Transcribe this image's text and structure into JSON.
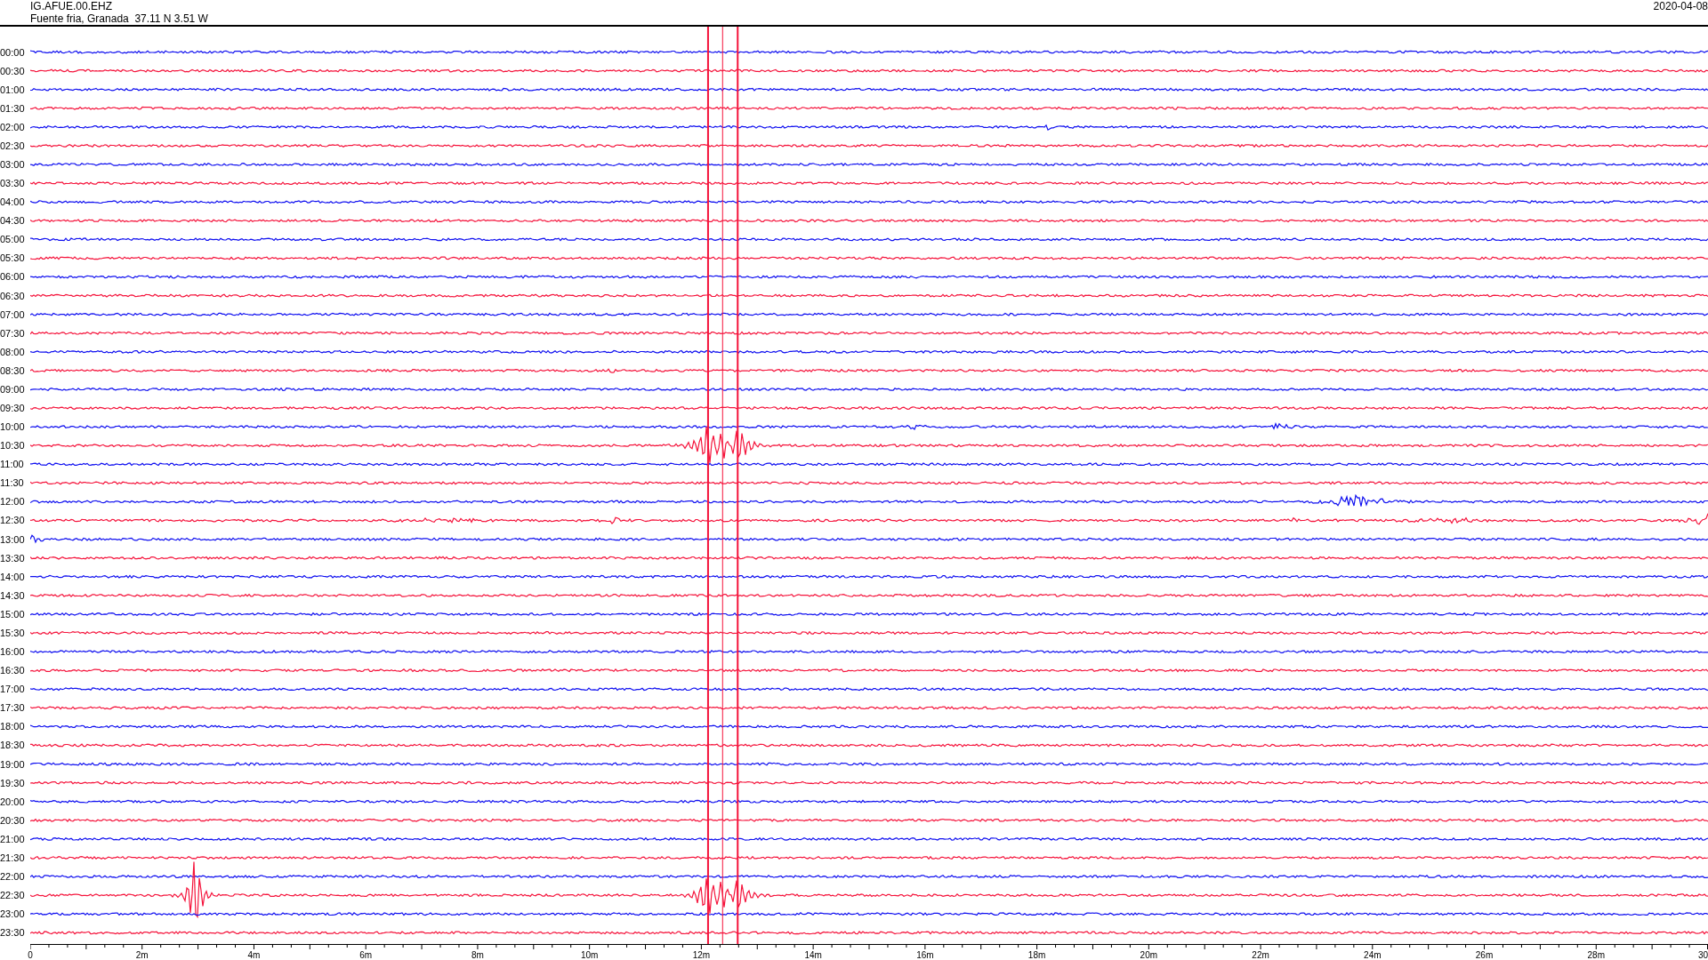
{
  "header": {
    "station": "IG.AFUE.00.EHZ",
    "location": "Fuente fria, Granada  37.11 N 3.51 W",
    "date": "2020-04-08"
  },
  "rows": [
    {
      "label": "00:00",
      "color": "#1010f0"
    },
    {
      "label": "00:30",
      "color": "#f5143c"
    },
    {
      "label": "01:00",
      "color": "#1010f0"
    },
    {
      "label": "01:30",
      "color": "#f5143c"
    },
    {
      "label": "02:00",
      "color": "#1010f0"
    },
    {
      "label": "02:30",
      "color": "#f5143c"
    },
    {
      "label": "03:00",
      "color": "#1010f0"
    },
    {
      "label": "03:30",
      "color": "#f5143c"
    },
    {
      "label": "04:00",
      "color": "#1010f0"
    },
    {
      "label": "04:30",
      "color": "#f5143c"
    },
    {
      "label": "05:00",
      "color": "#1010f0"
    },
    {
      "label": "05:30",
      "color": "#f5143c"
    },
    {
      "label": "06:00",
      "color": "#1010f0"
    },
    {
      "label": "06:30",
      "color": "#f5143c"
    },
    {
      "label": "07:00",
      "color": "#1010f0"
    },
    {
      "label": "07:30",
      "color": "#f5143c"
    },
    {
      "label": "08:00",
      "color": "#1010f0"
    },
    {
      "label": "08:30",
      "color": "#f5143c"
    },
    {
      "label": "09:00",
      "color": "#1010f0"
    },
    {
      "label": "09:30",
      "color": "#f5143c"
    },
    {
      "label": "10:00",
      "color": "#1010f0"
    },
    {
      "label": "10:30",
      "color": "#f5143c"
    },
    {
      "label": "11:00",
      "color": "#1010f0"
    },
    {
      "label": "11:30",
      "color": "#f5143c"
    },
    {
      "label": "12:00",
      "color": "#1010f0"
    },
    {
      "label": "12:30",
      "color": "#f5143c"
    },
    {
      "label": "13:00",
      "color": "#1010f0"
    },
    {
      "label": "13:30",
      "color": "#f5143c"
    },
    {
      "label": "14:00",
      "color": "#1010f0"
    },
    {
      "label": "14:30",
      "color": "#f5143c"
    },
    {
      "label": "15:00",
      "color": "#1010f0"
    },
    {
      "label": "15:30",
      "color": "#f5143c"
    },
    {
      "label": "16:00",
      "color": "#1010f0"
    },
    {
      "label": "16:30",
      "color": "#f5143c"
    },
    {
      "label": "17:00",
      "color": "#1010f0"
    },
    {
      "label": "17:30",
      "color": "#f5143c"
    },
    {
      "label": "18:00",
      "color": "#1010f0"
    },
    {
      "label": "18:30",
      "color": "#f5143c"
    },
    {
      "label": "19:00",
      "color": "#1010f0"
    },
    {
      "label": "19:30",
      "color": "#f5143c"
    },
    {
      "label": "20:00",
      "color": "#1010f0"
    },
    {
      "label": "20:30",
      "color": "#f5143c"
    },
    {
      "label": "21:00",
      "color": "#1010f0"
    },
    {
      "label": "21:30",
      "color": "#f5143c"
    },
    {
      "label": "22:00",
      "color": "#1010f0"
    },
    {
      "label": "22:30",
      "color": "#f5143c"
    },
    {
      "label": "23:00",
      "color": "#1010f0"
    },
    {
      "label": "23:30",
      "color": "#f5143c"
    }
  ],
  "time_axis": {
    "ticks": [
      "0",
      "2m",
      "4m",
      "6m",
      "8m",
      "10m",
      "12m",
      "14m",
      "16m",
      "18m",
      "20m",
      "22m",
      "24m",
      "26m",
      "28m",
      "30"
    ]
  }
}
